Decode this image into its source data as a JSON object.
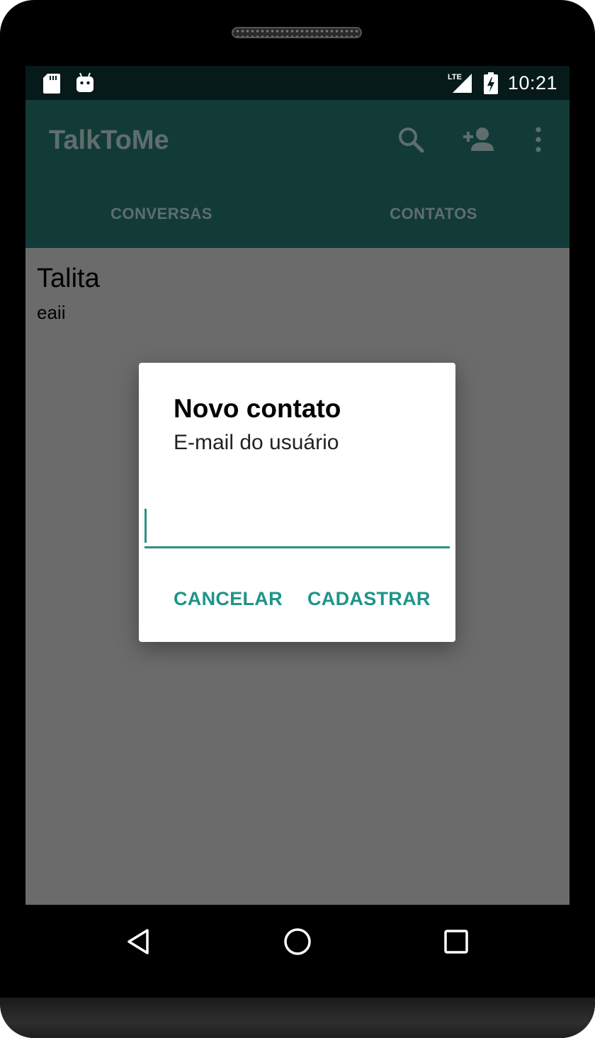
{
  "status_bar": {
    "time": "10:21",
    "icons": [
      "sd-card-icon",
      "android-debug-icon",
      "lte-signal-icon",
      "battery-charging-icon"
    ],
    "network_label": "LTE"
  },
  "app_bar": {
    "title": "TalkToMe",
    "actions": [
      "search-icon",
      "add-contact-icon",
      "overflow-menu-icon"
    ],
    "background": "#123b38"
  },
  "tabs": [
    {
      "label": "CONVERSAS"
    },
    {
      "label": "CONTATOS"
    }
  ],
  "conversations": [
    {
      "name": "Talita",
      "last_message": "eaii"
    }
  ],
  "dialog": {
    "title": "Novo contato",
    "message": "E-mail do usuário",
    "input_value": "",
    "cancel_label": "CANCELAR",
    "confirm_label": "CADASTRAR",
    "accent": "#1f9488"
  },
  "nav_bar": {
    "buttons": [
      "back-icon",
      "home-icon",
      "recents-icon"
    ]
  }
}
